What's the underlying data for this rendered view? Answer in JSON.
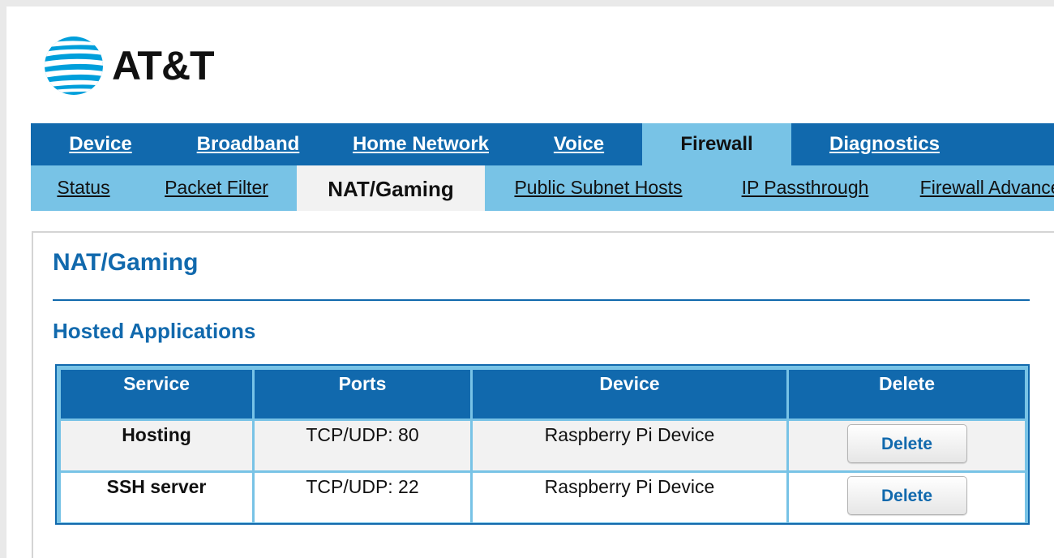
{
  "brand": {
    "name": "AT&T",
    "accent": "#1169ad",
    "light_accent": "#78c3e6"
  },
  "nav": {
    "main_tabs": [
      {
        "label": "Device"
      },
      {
        "label": "Broadband"
      },
      {
        "label": "Home Network"
      },
      {
        "label": "Voice"
      },
      {
        "label": "Firewall",
        "active": true
      },
      {
        "label": "Diagnostics"
      }
    ],
    "sub_tabs": [
      {
        "label": "Status"
      },
      {
        "label": "Packet Filter"
      },
      {
        "label": "NAT/Gaming",
        "active": true
      },
      {
        "label": "Public Subnet Hosts"
      },
      {
        "label": "IP Passthrough"
      },
      {
        "label": "Firewall Advanced"
      }
    ]
  },
  "main": {
    "title": "NAT/Gaming",
    "section_title": "Hosted Applications",
    "table": {
      "headers": [
        "Service",
        "Ports",
        "Device",
        "Delete"
      ],
      "rows": [
        {
          "service": "Hosting",
          "ports": "TCP/UDP: 80",
          "device": "Raspberry Pi Device",
          "action": "Delete"
        },
        {
          "service": "SSH server",
          "ports": "TCP/UDP: 22",
          "device": "Raspberry Pi Device",
          "action": "Delete"
        }
      ]
    }
  }
}
